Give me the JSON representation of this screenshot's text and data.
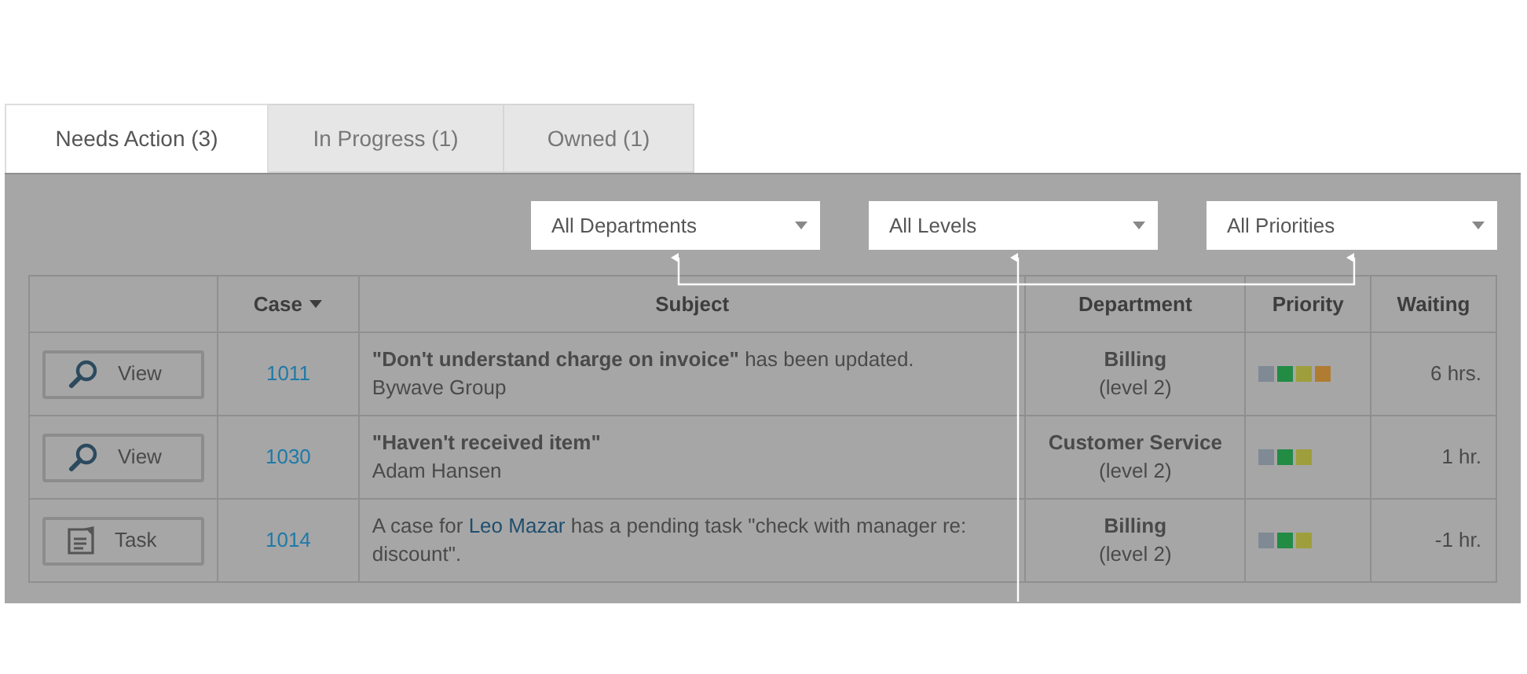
{
  "tabs": [
    {
      "label": "Needs Action (3)",
      "selected": true
    },
    {
      "label": "In Progress (1)",
      "selected": false
    },
    {
      "label": "Owned (1)",
      "selected": false
    }
  ],
  "filters": [
    {
      "value": "All Departments"
    },
    {
      "value": "All Levels"
    },
    {
      "value": "All Priorities"
    }
  ],
  "table": {
    "columns": [
      {},
      {
        "label": "Case",
        "sorted": true
      },
      {
        "label": "Subject"
      },
      {
        "label": "Department"
      },
      {
        "label": "Priority"
      },
      {
        "label": "Waiting"
      }
    ],
    "rows": [
      {
        "action": {
          "label": "View",
          "kind": "view"
        },
        "case": "1011",
        "subject": [
          {
            "kind": "text",
            "text": "**\"Don't understand charge on invoice\"** has been updated."
          }
        ],
        "customer": "Bywave Group",
        "department": "Billing",
        "level": "(level 2)",
        "priority": [
          {
            "color": "#7f8a94"
          },
          {
            "color": "#228b44"
          },
          {
            "color": "#9e9e3c"
          },
          {
            "color": "#b07c32"
          }
        ],
        "waiting": "6 hrs."
      },
      {
        "action": {
          "label": "View",
          "kind": "view"
        },
        "case": "1030",
        "subject": [
          {
            "kind": "text",
            "text": "**\"Haven't received item\"**"
          }
        ],
        "customer": "Adam Hansen",
        "department": "Customer Service",
        "level": "(level 2)",
        "priority": [
          {
            "color": "#7f8a94"
          },
          {
            "color": "#228b44"
          },
          {
            "color": "#9e9e3c"
          }
        ],
        "waiting": "1 hr."
      },
      {
        "action": {
          "label": "Task",
          "kind": "task"
        },
        "case": "1014",
        "subject": [
          {
            "kind": "text",
            "text": "A case for "
          },
          {
            "kind": "link",
            "text": "Leo Mazar"
          },
          {
            "kind": "text",
            "text": " has a pending task \"check with manager re: discount\"."
          }
        ],
        "department": "Billing",
        "level": "(level 2)",
        "priority": [
          {
            "color": "#7f8a94"
          },
          {
            "color": "#228b44"
          },
          {
            "color": "#9e9e3c"
          }
        ],
        "waiting": "-1 hr."
      }
    ]
  }
}
